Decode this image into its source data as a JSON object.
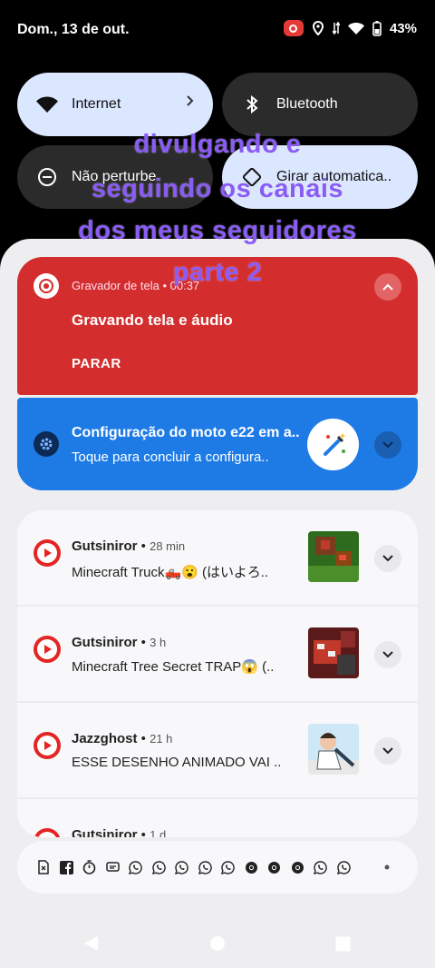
{
  "status_bar": {
    "date": "Dom., 13 de out.",
    "battery": "43%"
  },
  "quick_settings": {
    "internet": "Internet",
    "bluetooth": "Bluetooth",
    "dnd": "Não perturbe",
    "rotate": "Girar automatica.."
  },
  "recorder_card": {
    "app": "Gravador de tela",
    "time": "00:37",
    "title": "Gravando tela e áudio",
    "stop": "PARAR"
  },
  "setup_card": {
    "title": "Configuração do moto e22 em a..",
    "text": "Toque para concluir a configura.."
  },
  "notifications": [
    {
      "channel": "Gutsiniror",
      "time": "28 min",
      "text": "Minecraft Truck🛻😮 (はいよろ.."
    },
    {
      "channel": "Gutsiniror",
      "time": "3 h",
      "text": "Minecraft Tree Secret TRAP😱 (.."
    },
    {
      "channel": "Jazzghost",
      "time": "21 h",
      "text": "ESSE DESENHO ANIMADO VAI .."
    },
    {
      "channel": "Gutsiniror",
      "time": "1 d",
      "text": ""
    }
  ],
  "watermark": {
    "line1": "divulgando e",
    "line2": "seguindo os canais",
    "line3": "dos meus seguidores",
    "line4": "parte 2"
  },
  "colors": {
    "red_card": "#d32d2d",
    "blue_card": "#1e7be6",
    "watermark": "#8a5cf6",
    "tile_active": "#dbe6ff"
  },
  "minimized_icons": [
    "sim-icon",
    "facebook-icon",
    "timer-icon",
    "chat-icon",
    "whatsapp-icon",
    "whatsapp-icon",
    "whatsapp-icon",
    "whatsapp-icon",
    "whatsapp-icon",
    "chrome-icon",
    "chrome-icon",
    "chrome-icon",
    "whatsapp-icon",
    "whatsapp-icon",
    "dot-icon"
  ]
}
